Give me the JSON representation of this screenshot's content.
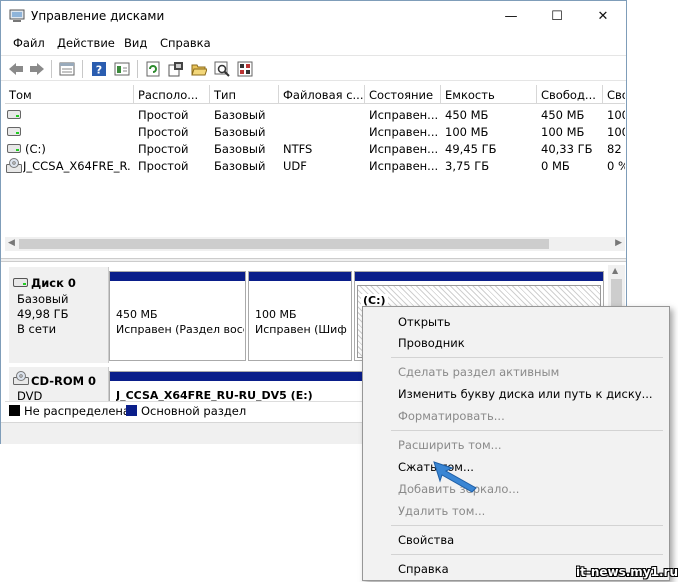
{
  "window": {
    "title": "Управление дисками",
    "minimize_glyph": "—",
    "maximize_glyph": "☐",
    "close_glyph": "✕"
  },
  "menu": {
    "items": [
      "Файл",
      "Действие",
      "Вид",
      "Справка"
    ]
  },
  "toolbar": {
    "icons": [
      "back-arrow-icon",
      "forward-arrow-icon",
      "properties-icon",
      "help-icon",
      "console-icon",
      "refresh-icon",
      "settings-icon",
      "folder-open-icon",
      "search-icon",
      "disk-check-icon"
    ]
  },
  "volumes": {
    "columns": [
      "Том",
      "Располо...",
      "Тип",
      "Файловая с...",
      "Состояние",
      "Емкость",
      "Свобод...",
      "Сво"
    ],
    "rows": [
      {
        "name": "",
        "layout": "Простой",
        "type": "Базовый",
        "fs": "",
        "status": "Исправен...",
        "capacity": "450 МБ",
        "free": "450 МБ",
        "pct": "100"
      },
      {
        "name": "",
        "layout": "Простой",
        "type": "Базовый",
        "fs": "",
        "status": "Исправен...",
        "capacity": "100 МБ",
        "free": "100 МБ",
        "pct": "100"
      },
      {
        "name": "(C:)",
        "layout": "Простой",
        "type": "Базовый",
        "fs": "NTFS",
        "status": "Исправен...",
        "capacity": "49,45 ГБ",
        "free": "40,33 ГБ",
        "pct": "82"
      },
      {
        "name": "J_CCSA_X64FRE_R...",
        "layout": "Простой",
        "type": "Базовый",
        "fs": "UDF",
        "status": "Исправен...",
        "capacity": "3,75 ГБ",
        "free": "0 МБ",
        "pct": "0 %"
      }
    ]
  },
  "disks": {
    "disk0": {
      "name": "Диск 0",
      "type": "Базовый",
      "size": "49,98 ГБ",
      "state": "В сети"
    },
    "cdrom0": {
      "name": "CD-ROM 0",
      "type": "DVD"
    },
    "partitions": [
      {
        "size": "450 МБ",
        "status": "Исправен (Раздел восс"
      },
      {
        "size": "100 МБ",
        "status": "Исправен (Шиф"
      },
      {
        "label": "(C:)"
      }
    ],
    "cd_volume": "J_CCSA_X64FRE_RU-RU_DV5  (E:)"
  },
  "legend": {
    "unallocated": "Не распределена",
    "primary": "Основной раздел",
    "unallocated_color": "#000000",
    "primary_color": "#0a1e8a"
  },
  "context_menu": {
    "items": [
      {
        "label": "Открыть",
        "enabled": true
      },
      {
        "label": "Проводник",
        "enabled": true
      },
      {
        "label": "Сделать раздел активным",
        "enabled": false
      },
      {
        "label": "Изменить букву диска или путь к диску...",
        "enabled": true
      },
      {
        "label": "Форматировать...",
        "enabled": false
      },
      {
        "label": "Расширить том...",
        "enabled": false
      },
      {
        "label": "Сжать том...",
        "enabled": true
      },
      {
        "label": "Добавить зеркало...",
        "enabled": false
      },
      {
        "label": "Удалить том...",
        "enabled": false
      },
      {
        "label": "Свойства",
        "enabled": true
      },
      {
        "label": "Справка",
        "enabled": true
      }
    ]
  },
  "watermark": "it-news.my1.ru"
}
